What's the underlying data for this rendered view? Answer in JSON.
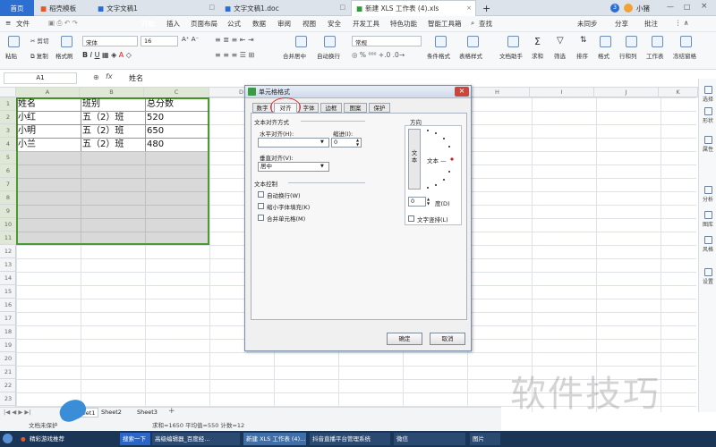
{
  "tabs": [
    {
      "label": "首页",
      "active": true
    },
    {
      "label": "稻壳模板"
    },
    {
      "label": "文字文稿1"
    },
    {
      "label": "文字文稿1.doc"
    },
    {
      "label": "新建 XLS 工作表 (4).xls",
      "current": true
    }
  ],
  "tab_add": "+",
  "top_right": {
    "badge": "3",
    "user": "小猪"
  },
  "menu": {
    "file": "文件",
    "items": [
      "开始",
      "插入",
      "页面布局",
      "公式",
      "数据",
      "审阅",
      "视图",
      "安全",
      "开发工具",
      "特色功能",
      "智能工具箱"
    ],
    "search": "查找",
    "sync": "未同步",
    "share": "分享",
    "comment": "批注"
  },
  "ribbon": {
    "paste": "粘贴",
    "cut": "剪切",
    "copy": "复制",
    "format_painter": "格式刷",
    "font_name": "宋体",
    "font_size": "16",
    "merge_center": "合并居中",
    "auto_wrap": "自动换行",
    "number_format": "常规",
    "conditional_format": "条件格式",
    "table_style": "表格样式",
    "doc_assistant": "文档助手",
    "sum": "求和",
    "filter": "筛选",
    "sort": "排序",
    "format": "格式",
    "row_col": "行和列",
    "worksheet": "工作表",
    "freeze": "冻结窗格"
  },
  "formula_bar": {
    "name_box": "A1",
    "fx": "fx",
    "content": "姓名"
  },
  "columns": [
    "A",
    "B",
    "C",
    "D",
    "E",
    "F",
    "G",
    "H",
    "I",
    "J",
    "K",
    "L"
  ],
  "rows": [
    "1",
    "2",
    "3",
    "4",
    "5",
    "6",
    "7",
    "8",
    "9",
    "10",
    "11",
    "12",
    "13",
    "14",
    "15",
    "16",
    "17",
    "18",
    "19",
    "20",
    "21",
    "22",
    "23"
  ],
  "table": [
    [
      "姓名",
      "班别",
      "总分数"
    ],
    [
      "小红",
      "五（2）班",
      "520"
    ],
    [
      "小明",
      "五（2）班",
      "650"
    ],
    [
      "小兰",
      "五（2）班",
      "480"
    ]
  ],
  "dialog": {
    "title": "单元格格式",
    "tabs": [
      "数字",
      "对齐",
      "字体",
      "边框",
      "图案",
      "保护"
    ],
    "active_tab": "对齐",
    "section_align": "文本对齐方式",
    "h_align_label": "水平对齐(H):",
    "h_align_value": "",
    "indent_label": "缩进(I):",
    "indent_value": "0",
    "v_align_label": "垂直对齐(V):",
    "v_align_value": "居中",
    "section_control": "文本控制",
    "wrap": "自动换行(W)",
    "shrink": "缩小字体填充(K)",
    "merge": "合并单元格(M)",
    "orientation": "方向",
    "vertical_text": "文本",
    "dial_text": "文本 —",
    "degree_value": "0",
    "degree_label": "度(D)",
    "vertical_text_check": "文字竖排(L)",
    "ok": "确定",
    "cancel": "取消"
  },
  "right_panel": [
    "选择",
    "形状",
    "属性",
    "分析",
    "图库",
    "风格",
    "设置"
  ],
  "sheets": [
    "Sheet1",
    "Sheet2",
    "Sheet3"
  ],
  "status": {
    "text": "求和=1650  平均值=550  计数=12",
    "doc_protect": "文档未保护"
  },
  "taskbar": [
    "精彩游戏推荐",
    "搜索一下",
    "高级编辑器_百度经...",
    "新建 XLS 工作表 (4)...",
    "抖音直播平台管理系统",
    "微信",
    "图片"
  ],
  "watermark": "软件技巧",
  "colors": {
    "accent": "#4b9a30",
    "selection": "#d9d9d9",
    "highlight_circle": "#d62b2b",
    "taskbar": "#1b3557"
  }
}
